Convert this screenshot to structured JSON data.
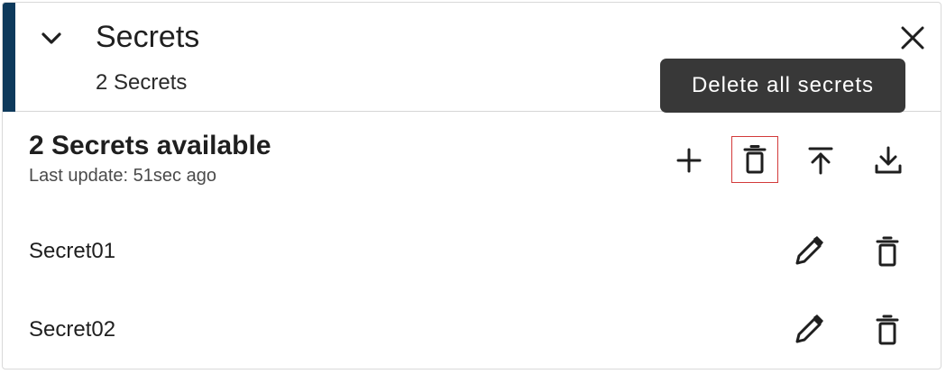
{
  "panel": {
    "title": "Secrets",
    "subtitle": "2 Secrets",
    "accent_color": "#0e3a5c"
  },
  "tooltip": {
    "text": "Delete all secrets"
  },
  "toolbar": {
    "title": "2 Secrets available",
    "last_update": "Last update: 51sec ago",
    "actions": [
      {
        "name": "add",
        "icon": "plus-icon"
      },
      {
        "name": "delete-all",
        "icon": "trash-icon",
        "highlighted": true,
        "highlight_color": "#d33a3a"
      },
      {
        "name": "upload",
        "icon": "upload-icon"
      },
      {
        "name": "download",
        "icon": "download-icon"
      }
    ]
  },
  "secrets": [
    {
      "name": "Secret01",
      "actions": [
        "pencil-icon",
        "trash-icon"
      ]
    },
    {
      "name": "Secret02",
      "actions": [
        "pencil-icon",
        "trash-icon"
      ]
    }
  ]
}
